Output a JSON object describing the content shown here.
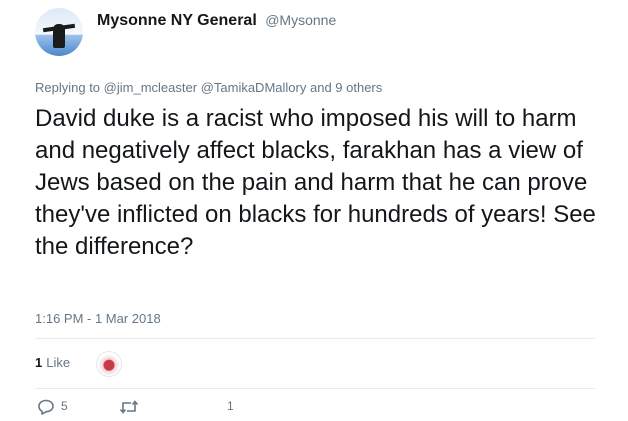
{
  "user": {
    "display_name": "Mysonne NY General",
    "handle": "@Mysonne"
  },
  "reply": {
    "prefix": "Replying to",
    "mention1": "@jim_mcleaster",
    "mention2": "@TamikaDMallory",
    "suffix": "and 9 others"
  },
  "tweet": {
    "text": "David duke is a racist who imposed his will to harm and negatively affect blacks, farakhan has a view of Jews based on the pain and harm that he can prove they've inflicted on blacks for hundreds of years! See the difference?",
    "timestamp": "1:16 PM - 1 Mar 2018"
  },
  "stats": {
    "likes_count": "1",
    "likes_label": "Like"
  },
  "actions": {
    "reply_count": "5",
    "retweet_count": "",
    "like_count": "1",
    "icons": [
      "reply-icon",
      "retweet-icon",
      "heart-icon"
    ]
  },
  "colors": {
    "text": "#14171a",
    "muted": "#657786",
    "divider": "#e6ecf0"
  }
}
